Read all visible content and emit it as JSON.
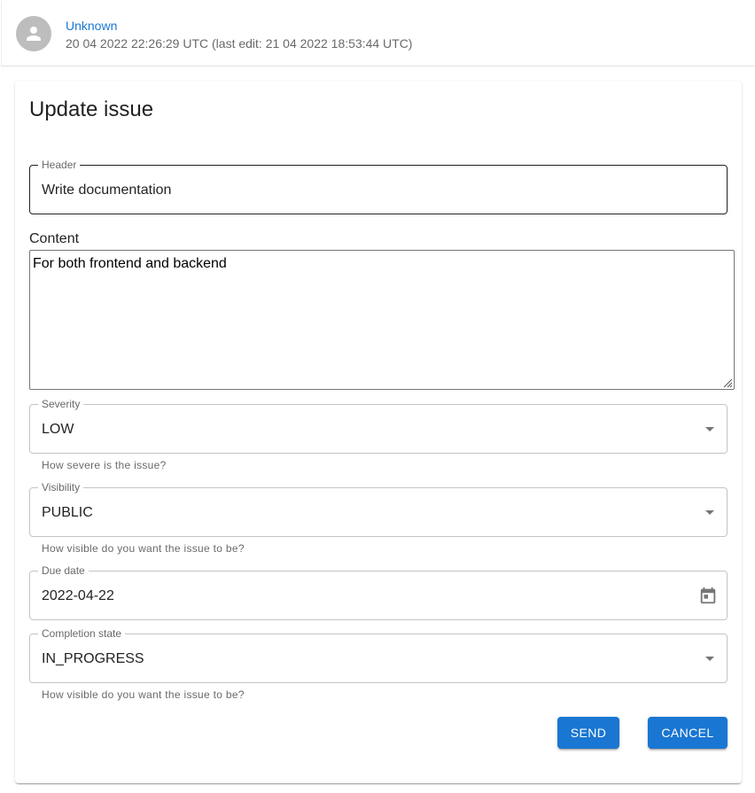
{
  "post_header": {
    "author": "Unknown",
    "timestamp": "20 04 2022 22:26:29 UTC (last edit: 21 04 2022 18:53:44 UTC)",
    "avatar_icon": "person-icon"
  },
  "form": {
    "title": "Update issue",
    "header_field": {
      "label": "Header",
      "value": "Write documentation"
    },
    "content_field": {
      "label": "Content",
      "value": "For both frontend and backend"
    },
    "severity_field": {
      "label": "Severity",
      "value": "LOW",
      "helper": "How severe is the issue?"
    },
    "visibility_field": {
      "label": "Visibility",
      "value": "PUBLIC",
      "helper": "How visible do you want the issue to be?"
    },
    "due_date_field": {
      "label": "Due date",
      "value": "2022-04-22",
      "icon": "calendar-icon"
    },
    "completion_field": {
      "label": "Completion state",
      "value": "IN_PROGRESS",
      "helper": "How visible do you want the issue to be?"
    },
    "send_label": "SEND",
    "cancel_label": "CANCEL"
  },
  "colors": {
    "primary": "#1976d2",
    "avatar_bg": "#bdbdbd"
  }
}
